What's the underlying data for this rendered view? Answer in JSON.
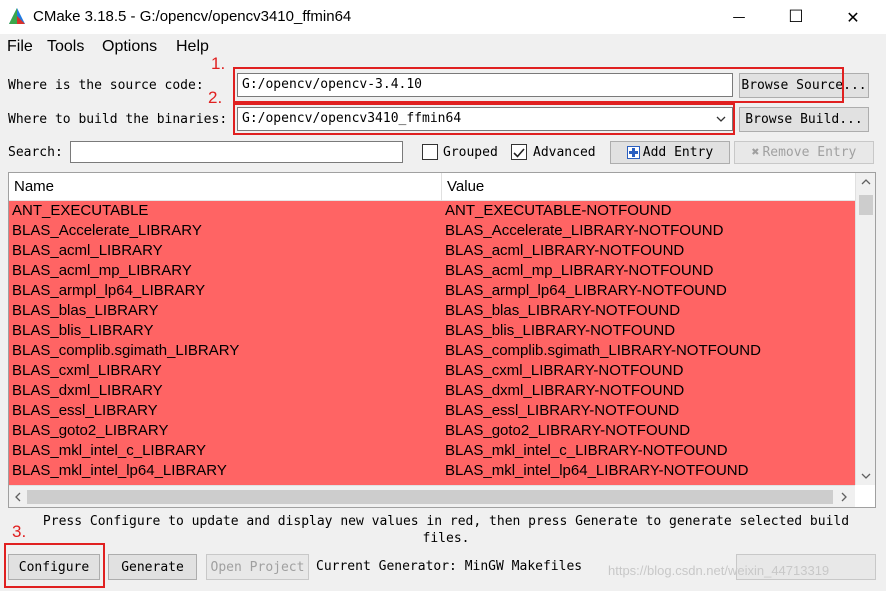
{
  "window": {
    "title": "CMake 3.18.5 - G:/opencv/opencv3410_ffmin64",
    "minimize_glyph": "—",
    "maximize_glyph": "☐",
    "close_glyph": "✕"
  },
  "menu": [
    "File",
    "Tools",
    "Options",
    "Help"
  ],
  "source": {
    "label": "Where is the source code:",
    "value": "G:/opencv/opencv-3.4.10",
    "browse_label": "Browse Source..."
  },
  "build": {
    "label": "Where to build the binaries:",
    "value": "G:/opencv/opencv3410_ffmin64",
    "browse_label": "Browse Build..."
  },
  "search": {
    "label": "Search:",
    "value": ""
  },
  "options": {
    "grouped_label": "Grouped",
    "grouped_checked": false,
    "advanced_label": "Advanced",
    "advanced_checked": true,
    "add_entry_label": "Add Entry",
    "remove_entry_label": "Remove Entry"
  },
  "annotations": [
    "1.",
    "2.",
    "3."
  ],
  "table": {
    "columns": [
      "Name",
      "Value"
    ],
    "rows": [
      [
        "ANT_EXECUTABLE",
        "ANT_EXECUTABLE-NOTFOUND"
      ],
      [
        "BLAS_Accelerate_LIBRARY",
        "BLAS_Accelerate_LIBRARY-NOTFOUND"
      ],
      [
        "BLAS_acml_LIBRARY",
        "BLAS_acml_LIBRARY-NOTFOUND"
      ],
      [
        "BLAS_acml_mp_LIBRARY",
        "BLAS_acml_mp_LIBRARY-NOTFOUND"
      ],
      [
        "BLAS_armpl_lp64_LIBRARY",
        "BLAS_armpl_lp64_LIBRARY-NOTFOUND"
      ],
      [
        "BLAS_blas_LIBRARY",
        "BLAS_blas_LIBRARY-NOTFOUND"
      ],
      [
        "BLAS_blis_LIBRARY",
        "BLAS_blis_LIBRARY-NOTFOUND"
      ],
      [
        "BLAS_complib.sgimath_LIBRARY",
        "BLAS_complib.sgimath_LIBRARY-NOTFOUND"
      ],
      [
        "BLAS_cxml_LIBRARY",
        "BLAS_cxml_LIBRARY-NOTFOUND"
      ],
      [
        "BLAS_dxml_LIBRARY",
        "BLAS_dxml_LIBRARY-NOTFOUND"
      ],
      [
        "BLAS_essl_LIBRARY",
        "BLAS_essl_LIBRARY-NOTFOUND"
      ],
      [
        "BLAS_goto2_LIBRARY",
        "BLAS_goto2_LIBRARY-NOTFOUND"
      ],
      [
        "BLAS_mkl_intel_c_LIBRARY",
        "BLAS_mkl_intel_c_LIBRARY-NOTFOUND"
      ],
      [
        "BLAS_mkl_intel_lp64_LIBRARY",
        "BLAS_mkl_intel_lp64_LIBRARY-NOTFOUND"
      ]
    ],
    "row_color": "#ff6464"
  },
  "help_text": "Press Configure to update and display new values in red, then press Generate to generate selected build files.",
  "buttons": {
    "configure": "Configure",
    "generate": "Generate",
    "open_project": "Open Project"
  },
  "generator_text": "Current Generator: MinGW Makefiles",
  "watermark": "https://blog.csdn.net/weixin_44713319",
  "colors": {
    "annotation": "#e02020",
    "row_highlight": "#ff6464"
  }
}
